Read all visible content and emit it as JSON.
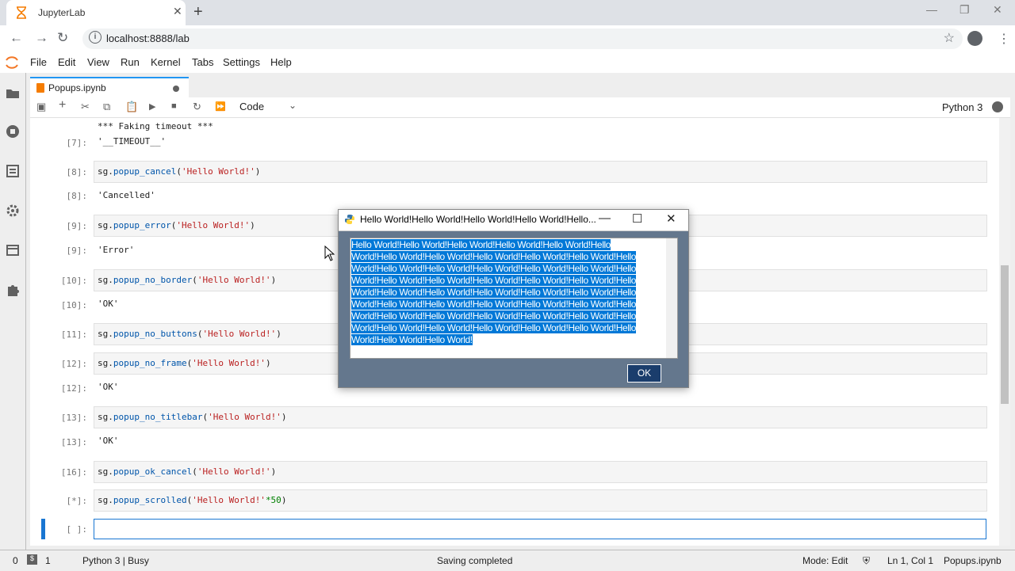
{
  "browser": {
    "tab_title": "JupyterLab",
    "new_tab_icon": "+",
    "url": "localhost:8888/lab"
  },
  "menu": [
    "File",
    "Edit",
    "View",
    "Run",
    "Kernel",
    "Tabs",
    "Settings",
    "Help"
  ],
  "doc_tab": {
    "name": "Popups.ipynb"
  },
  "toolbar": {
    "cell_type": "Code",
    "kernel": "Python 3"
  },
  "cells": [
    {
      "kind": "out",
      "text": "*** Faking timeout ***"
    },
    {
      "kind": "out",
      "prompt": "[7]:",
      "text": "'__TIMEOUT__'"
    },
    {
      "kind": "in",
      "prompt": "[8]:",
      "fn": "popup_cancel",
      "arg": "'Hello World!'"
    },
    {
      "kind": "out",
      "prompt": "[8]:",
      "text": "'Cancelled'"
    },
    {
      "kind": "in",
      "prompt": "[9]:",
      "fn": "popup_error",
      "arg": "'Hello World!'"
    },
    {
      "kind": "out",
      "prompt": "[9]:",
      "text": "'Error'"
    },
    {
      "kind": "in",
      "prompt": "[10]:",
      "fn": "popup_no_border",
      "arg": "'Hello World!'"
    },
    {
      "kind": "out",
      "prompt": "[10]:",
      "text": "'OK'"
    },
    {
      "kind": "in",
      "prompt": "[11]:",
      "fn": "popup_no_buttons",
      "arg": "'Hello World!'"
    },
    {
      "kind": "in",
      "prompt": "[12]:",
      "fn": "popup_no_frame",
      "arg": "'Hello World!'"
    },
    {
      "kind": "out",
      "prompt": "[12]:",
      "text": "'OK'"
    },
    {
      "kind": "in",
      "prompt": "[13]:",
      "fn": "popup_no_titlebar",
      "arg": "'Hello World!'"
    },
    {
      "kind": "out",
      "prompt": "[13]:",
      "text": "'OK'"
    },
    {
      "kind": "in",
      "prompt": "[16]:",
      "fn": "popup_ok_cancel",
      "arg": "'Hello World!'"
    },
    {
      "kind": "in",
      "prompt": "[*]:",
      "fn": "popup_scrolled",
      "arg": "'Hello World!'",
      "suffix": "*50"
    },
    {
      "kind": "active",
      "prompt": "[ ]:"
    }
  ],
  "popup": {
    "title": "Hello World!Hello World!Hello World!Hello World!Hello...",
    "text_lines": [
      "Hello World!Hello World!Hello World!Hello World!Hello World!Hello",
      "World!Hello World!Hello World!Hello World!Hello World!Hello World!Hello",
      "World!Hello World!Hello World!Hello World!Hello World!Hello World!Hello",
      "World!Hello World!Hello World!Hello World!Hello World!Hello World!Hello",
      "World!Hello World!Hello World!Hello World!Hello World!Hello World!Hello",
      "World!Hello World!Hello World!Hello World!Hello World!Hello World!Hello",
      "World!Hello World!Hello World!Hello World!Hello World!Hello World!Hello",
      "World!Hello World!Hello World!Hello World!Hello World!Hello World!Hello",
      "World!Hello World!Hello World!"
    ],
    "ok_label": "OK"
  },
  "status": {
    "terminals": "0",
    "kernels": "1",
    "kernel_status": "Python 3 | Busy",
    "message": "Saving completed",
    "mode": "Mode: Edit",
    "position": "Ln 1, Col 1",
    "file": "Popups.ipynb"
  }
}
